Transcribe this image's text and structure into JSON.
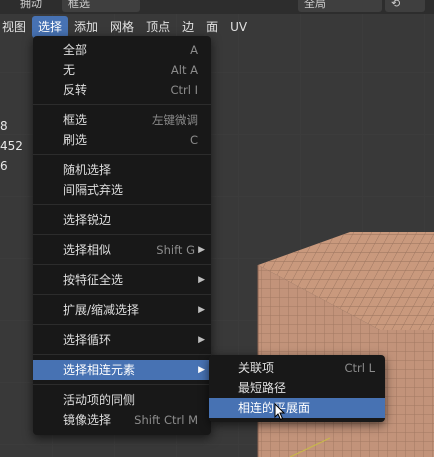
{
  "tool_header": {
    "left_label": "拥动",
    "mode_field": "框选",
    "orientation_field": "全局"
  },
  "menubar": {
    "items": [
      {
        "label": "视图"
      },
      {
        "label": "选择"
      },
      {
        "label": "添加"
      },
      {
        "label": "网格"
      },
      {
        "label": "顶点"
      },
      {
        "label": "边"
      },
      {
        "label": "面"
      },
      {
        "label": "UV"
      }
    ]
  },
  "stats": [
    "8",
    "452",
    "6"
  ],
  "select_menu": {
    "groups": [
      [
        {
          "label": "全部",
          "shortcut": "A"
        },
        {
          "label": "无",
          "shortcut": "Alt A"
        },
        {
          "label": "反转",
          "shortcut": "Ctrl I"
        }
      ],
      [
        {
          "label": "框选",
          "shortcut": "左键微调"
        },
        {
          "label": "刷选",
          "shortcut": "C"
        }
      ],
      [
        {
          "label": "随机选择",
          "shortcut": ""
        },
        {
          "label": "间隔式弃选",
          "shortcut": ""
        }
      ],
      [
        {
          "label": "选择锐边",
          "shortcut": ""
        }
      ],
      [
        {
          "label": "选择相似",
          "shortcut": "Shift G"
        }
      ],
      [
        {
          "label": "按特征全选",
          "shortcut": ""
        }
      ],
      [
        {
          "label": "扩展/缩减选择",
          "shortcut": ""
        }
      ],
      [
        {
          "label": "选择循环",
          "shortcut": ""
        }
      ],
      [
        {
          "label": "选择相连元素",
          "shortcut": ""
        }
      ],
      [
        {
          "label": "活动项的同侧",
          "shortcut": ""
        },
        {
          "label": "镜像选择",
          "shortcut": "Shift Ctrl M"
        }
      ]
    ]
  },
  "submenu": {
    "items": [
      {
        "label": "关联项",
        "shortcut": "Ctrl L"
      },
      {
        "label": "最短路径",
        "shortcut": ""
      },
      {
        "label": "相连的平展面",
        "shortcut": ""
      }
    ]
  },
  "colors": {
    "highlight": "#4772b3",
    "menu_bg": "#181818",
    "cube_face": "#c89a7e"
  }
}
